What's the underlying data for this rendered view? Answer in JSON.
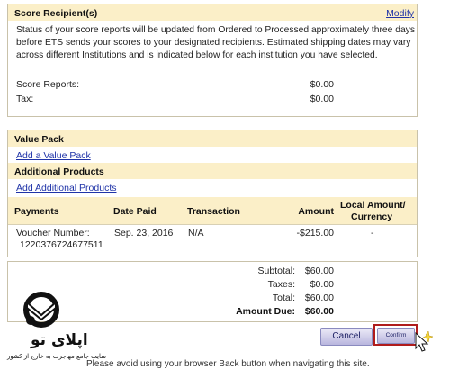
{
  "recipient": {
    "title": "Score Recipient(s)",
    "modify_label": "Modify",
    "description_lines": [
      "Status of your score reports will be updated from Ordered to Processed approximately three days",
      "before ETS sends your scores to your designated recipients. Estimated shipping dates may vary",
      "across different Institutions and is indicated below for each institution you have selected."
    ],
    "score_reports_label": "Score Reports:",
    "score_reports_value": "$0.00",
    "tax_label": "Tax:",
    "tax_value": "$0.00"
  },
  "value_pack": {
    "title": "Value Pack",
    "link_label": "Add a Value Pack"
  },
  "additional_products": {
    "title": "Additional Products",
    "link_label": "Add Additional Products"
  },
  "payments": {
    "headers": {
      "payments": "Payments",
      "date_paid": "Date Paid",
      "transaction": "Transaction",
      "amount": "Amount",
      "local_amount_line1": "Local Amount/",
      "local_amount_line2": "Currency"
    },
    "rows": [
      {
        "payment_line1": "Voucher Number:",
        "payment_line2": "1220376724677511",
        "date_paid": "Sep. 23, 2016",
        "transaction": "N/A",
        "amount": "-$215.00",
        "local_amount": "-"
      }
    ]
  },
  "totals": {
    "subtotal_label": "Subtotal:",
    "subtotal_value": "$60.00",
    "taxes_label": "Taxes:",
    "taxes_value": "$0.00",
    "total_label": "Total:",
    "total_value": "$60.00",
    "amount_due_label": "Amount Due:",
    "amount_due_value": "$60.00"
  },
  "buttons": {
    "cancel_label": "Cancel",
    "confirm_label": "Confirm Order"
  },
  "footer_text": "Please avoid using your browser Back button when navigating this site.",
  "watermark": {
    "name": "اپلای تو",
    "tagline": "سایت جامع مهاجرت به خارج از کشور"
  },
  "colors": {
    "section_band": "#fbefc8",
    "link": "#1f33a8",
    "confirm_highlight": "#b01c1c"
  }
}
